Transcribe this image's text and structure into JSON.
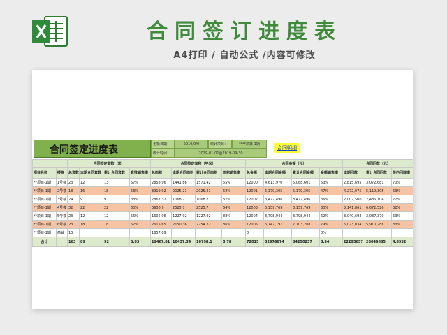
{
  "page": {
    "title": "合同签订进度表",
    "subtitle": "A4打印 / 自动公式 /内容可修改"
  },
  "colors": {
    "brand_green": "#3f8a3b",
    "title_green": "#80b14c",
    "header_green": "#ddeacc",
    "row_orange": "#f6c3a3",
    "link_yellow": "#ffff33"
  },
  "sheet": {
    "title": "合同签定进度表",
    "update_date_label": "更新日期：",
    "update_date_value": "2019/9/0",
    "stat_project_label": "统计项目：",
    "stat_project_value": "****项目-1期",
    "stat_time_label": "统计时间：",
    "stat_time_value": "2019-01-01至2019-09-30",
    "link_text": "合同明细",
    "group_headers": [
      "合同签定套数（套）",
      "合同签定面积（平米）",
      "合同金额（元）",
      "合同回款（元）"
    ],
    "col_headers": [
      "项目名称",
      "楼栋",
      "总套数",
      "本期合同套数",
      "累计合同套数",
      "套数销售率",
      "总面积",
      "本期合同面积",
      "累计合同面积",
      "面积销售率",
      "总金额",
      "本期合同金额",
      "累计合同金额",
      "金额销售率",
      "本期回款",
      "累计合同回款",
      "签约回款率"
    ],
    "rows": [
      {
        "style": "white",
        "cells": [
          "**项目-1期",
          "1号楼",
          "23",
          "12",
          "13",
          "57%",
          "2858.96",
          "1441.86",
          "1571.42",
          "55%",
          "12000",
          "4,613,970",
          "5,068,601",
          "53%",
          "2,815,695",
          "3,072,681",
          "70%"
        ]
      },
      {
        "style": "orange",
        "cells": [
          "**项目-1期",
          "2号楼",
          "18",
          "16",
          "18",
          "53%",
          "3919.92",
          "2025.21",
          "2025.21",
          "62%",
          "12001",
          "6,179,305",
          "5,179,305",
          "47%",
          "4,272,075",
          "5,119,305",
          "63%"
        ]
      },
      {
        "style": "white",
        "cells": [
          "**项目-1期",
          "3号楼",
          "24",
          "9",
          "9",
          "38%",
          "2862.32",
          "1068.27",
          "1068.27",
          "37%",
          "12002",
          "3,477,496",
          "3,477,496",
          "36%",
          "2,002,500",
          "2,486,104",
          "72%"
        ]
      },
      {
        "style": "orange",
        "cells": [
          "**项目-1期",
          "4号楼",
          "32",
          "22",
          "22",
          "60%",
          "3936.9",
          "2525.7",
          "2525.7",
          "64%",
          "12003",
          "8,159,769",
          "8,159,769",
          "60%",
          "5,141,861",
          "6,672,526",
          "82%"
        ]
      },
      {
        "style": "white",
        "cells": [
          "**项目-1期",
          "5号楼",
          "23",
          "12",
          "12",
          "56%",
          "1605.96",
          "1227.92",
          "1227.92",
          "88%",
          "12004",
          "3,798,944",
          "3,798,944",
          "62%",
          "3,040,692",
          "3,987,379",
          "63%"
        ]
      },
      {
        "style": "orange",
        "cells": [
          "**项目-1期",
          "6号楼",
          "23",
          "18",
          "18",
          "57%",
          "2615.65",
          "2150.36",
          "2254.22",
          "86%",
          "12005",
          "6,747,191",
          "7,103,288",
          "79%",
          "5,023,034",
          "5,910,288",
          "83%"
        ]
      },
      {
        "style": "white",
        "cells": [
          "**项目-1期",
          "商铺",
          "13",
          "",
          "",
          "",
          "1657.09",
          "",
          "",
          "",
          "0",
          "",
          "",
          "0%",
          "",
          "",
          ""
        ]
      }
    ],
    "total": [
      "合计",
      "",
      "163",
      "89",
      "92",
      "3.83",
      "19467.81",
      "10437.34",
      "10798.1",
      "3.78",
      "72015",
      "32976674",
      "34250237",
      "3.54",
      "22295657",
      "28049685",
      "4.8932"
    ]
  }
}
